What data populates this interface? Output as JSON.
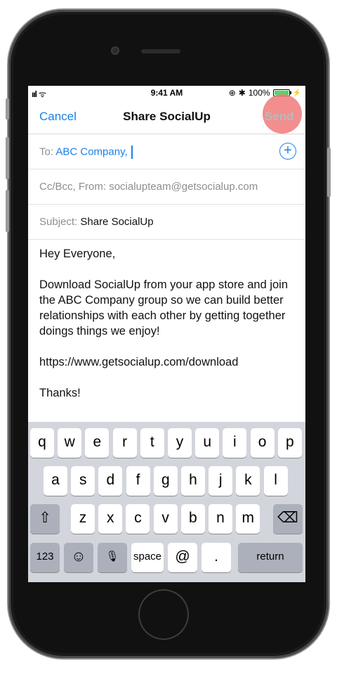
{
  "status_bar": {
    "signal": "ııl",
    "wifi": "ᯤ",
    "time": "9:41 AM",
    "battery": "100%",
    "battery_level": 1.0
  },
  "nav": {
    "cancel": "Cancel",
    "title": "Share SocialUp",
    "send": "Send"
  },
  "to": {
    "label": "To:",
    "value": "ABC Company,"
  },
  "cc": {
    "label": "Cc/Bcc, From:",
    "value": "socialupteam@getsocialup.com"
  },
  "subject": {
    "label": "Subject:",
    "value": "Share SocialUp"
  },
  "body": {
    "greeting": "Hey Everyone,",
    "paragraph": "Download SocialUp from your app store and join the ABC Company group so we can build better relationships with each other by getting together doings things we enjoy!",
    "link": "https://www.getsocialup.com/download",
    "closing": "Thanks!"
  },
  "keyboard": {
    "row1": [
      "q",
      "w",
      "e",
      "r",
      "t",
      "y",
      "u",
      "i",
      "o",
      "p"
    ],
    "row2": [
      "a",
      "s",
      "d",
      "f",
      "g",
      "h",
      "j",
      "k",
      "l"
    ],
    "row3": [
      "z",
      "x",
      "c",
      "v",
      "b",
      "n",
      "m"
    ],
    "shift": "⇧",
    "delete": "⌫",
    "numbers": "123",
    "emoji": "☺",
    "mic": "🎙",
    "space": "space",
    "at": "@",
    "period": ".",
    "return": "return"
  },
  "colors": {
    "accent": "#1a82e8",
    "send_highlight": "#f07a7a"
  }
}
